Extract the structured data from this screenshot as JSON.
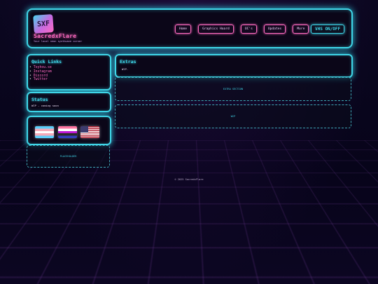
{
  "header": {
    "logo_text": "SXF",
    "site_title": "SacredxFlare",
    "tagline": "Your local neon synthwave corner",
    "nav": [
      "Home",
      "Graphics Hoard",
      "OC's",
      "Updates",
      "More"
    ],
    "vhs_toggle": "VHS ON/OFF"
  },
  "quick_links": {
    "title": "Quick Links",
    "items": [
      "Toyhou.se",
      "Instagram",
      "Discord",
      "Twitter"
    ]
  },
  "status": {
    "title": "Status",
    "text": "WIP - coming soon"
  },
  "flags": [
    "flag-trans",
    "flag-genderfluid",
    "flag-usa"
  ],
  "placeholder": "PLACEHOLDER",
  "extras": {
    "title": "Extras",
    "text": "WIP."
  },
  "extra_section": "EXTRA SECTION",
  "wip_box": "WIP",
  "footer": "© 2025 SacredxFlare",
  "colors": {
    "accent_cyan": "#3fd6e8",
    "accent_pink": "#ff6ac1",
    "background": "#050310"
  }
}
